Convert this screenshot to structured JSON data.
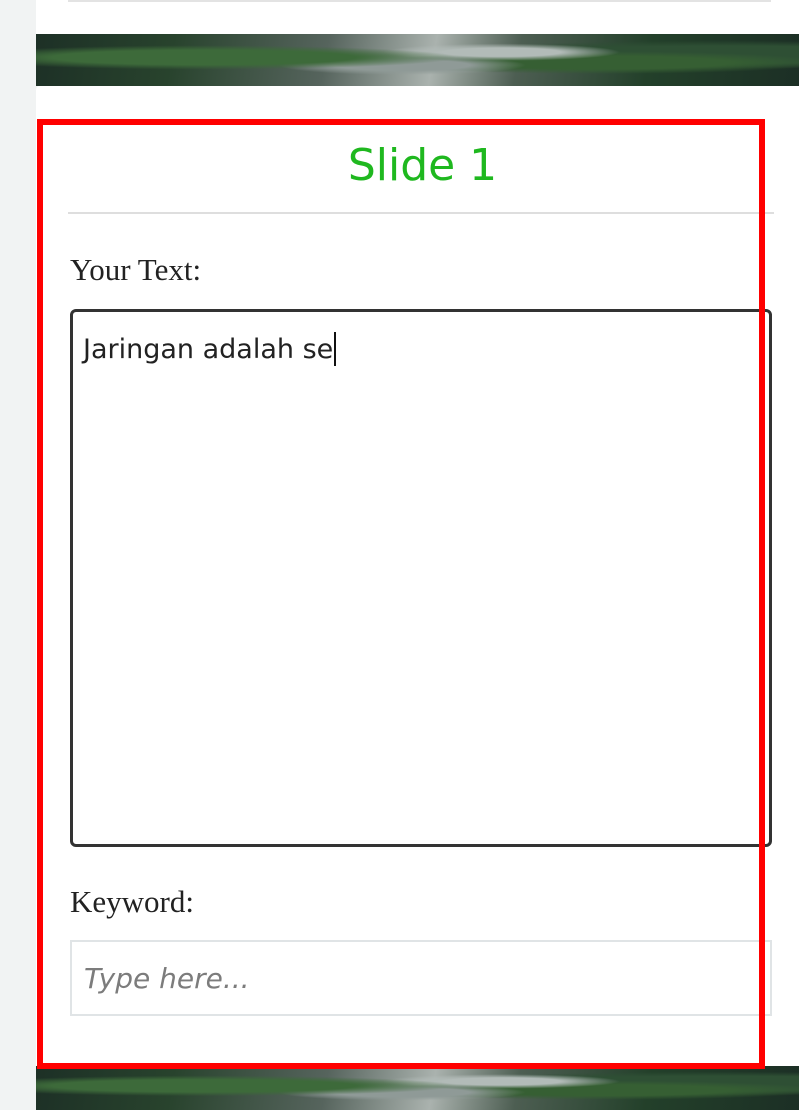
{
  "slide": {
    "title": "Slide 1",
    "text_label": "Your Text:",
    "text_value": "Jaringan adalah se",
    "keyword_label": "Keyword:",
    "keyword_placeholder": "Type here..."
  },
  "colors": {
    "title": "#1fb81f",
    "highlight_border": "#ff0000",
    "card_background": "#ffffff"
  }
}
